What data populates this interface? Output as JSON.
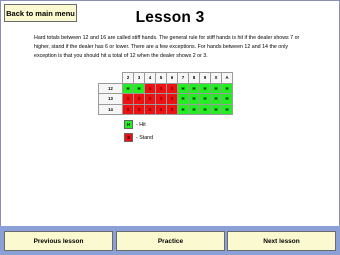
{
  "header": {
    "back_label": "Back to main menu",
    "title": "Lesson 3"
  },
  "lesson": {
    "description": "Hard totals between 12 and 16 are called stiff hands. The general rule for stiff hands is hit if the dealer shows 7 or higher, stand if the dealer has 6 or lower. There are a few exceptions. For hands between 12 and 14 the only exception is that you should hit a total of 12 when the dealer shows 2 or 3."
  },
  "strategy_table": {
    "dealer_cards": [
      "2",
      "3",
      "4",
      "5",
      "6",
      "7",
      "8",
      "9",
      "X",
      "A"
    ],
    "rows": [
      {
        "total": "12",
        "cells": [
          "H",
          "H",
          "S",
          "S",
          "S",
          "H",
          "H",
          "H",
          "H",
          "H"
        ]
      },
      {
        "total": "13",
        "cells": [
          "S",
          "S",
          "S",
          "S",
          "S",
          "H",
          "H",
          "H",
          "H",
          "H"
        ]
      },
      {
        "total": "14",
        "cells": [
          "S",
          "S",
          "S",
          "S",
          "S",
          "H",
          "H",
          "H",
          "H",
          "H"
        ]
      }
    ]
  },
  "legend": {
    "hit_symbol": "H",
    "hit_label": "- Hit",
    "stand_symbol": "S",
    "stand_label": "- Stand"
  },
  "footer": {
    "previous_label": "Previous lesson",
    "practice_label": "Practice",
    "next_label": "Next lesson"
  },
  "colors": {
    "hit": "#22ee22",
    "stand": "#ee1111",
    "button_bg": "#fbf9cf",
    "footer_bg": "#8aa0d6"
  }
}
